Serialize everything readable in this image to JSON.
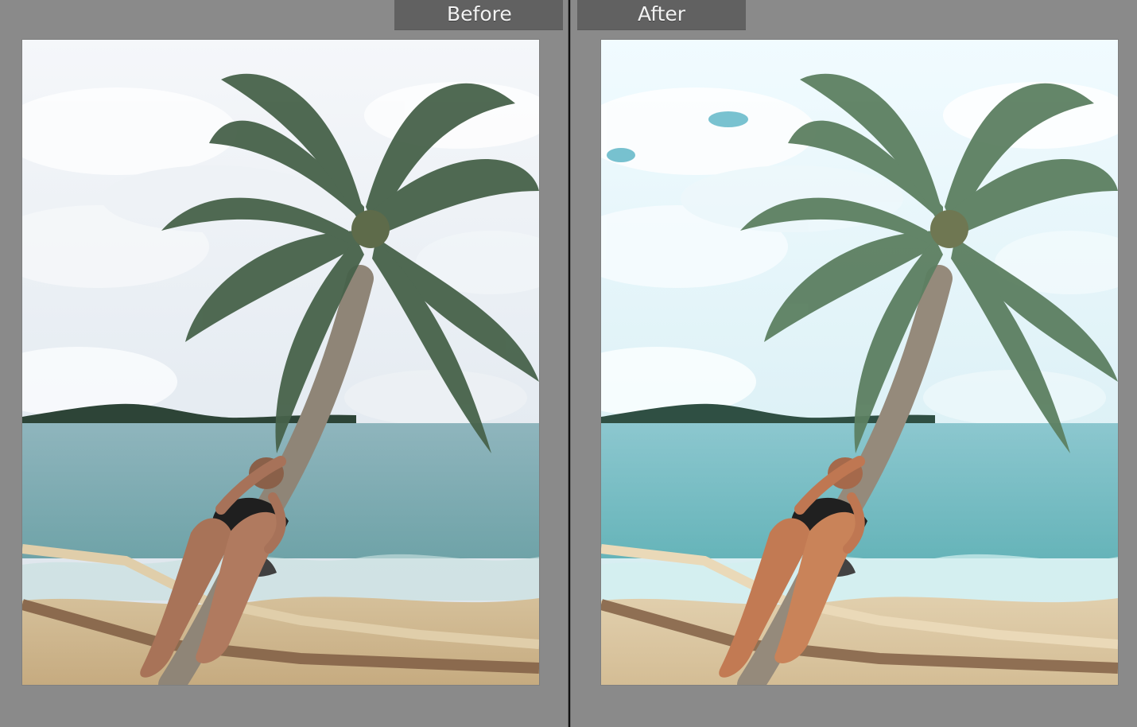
{
  "labels": {
    "before": "Before",
    "after": "After"
  },
  "colors": {
    "background": "#8a8a8a",
    "label_tab": "#616161",
    "label_text": "#f2f2f2",
    "divider": "#111111"
  },
  "icons": {
    "before_view": "beach-palm-image",
    "after_view": "beach-palm-image"
  }
}
